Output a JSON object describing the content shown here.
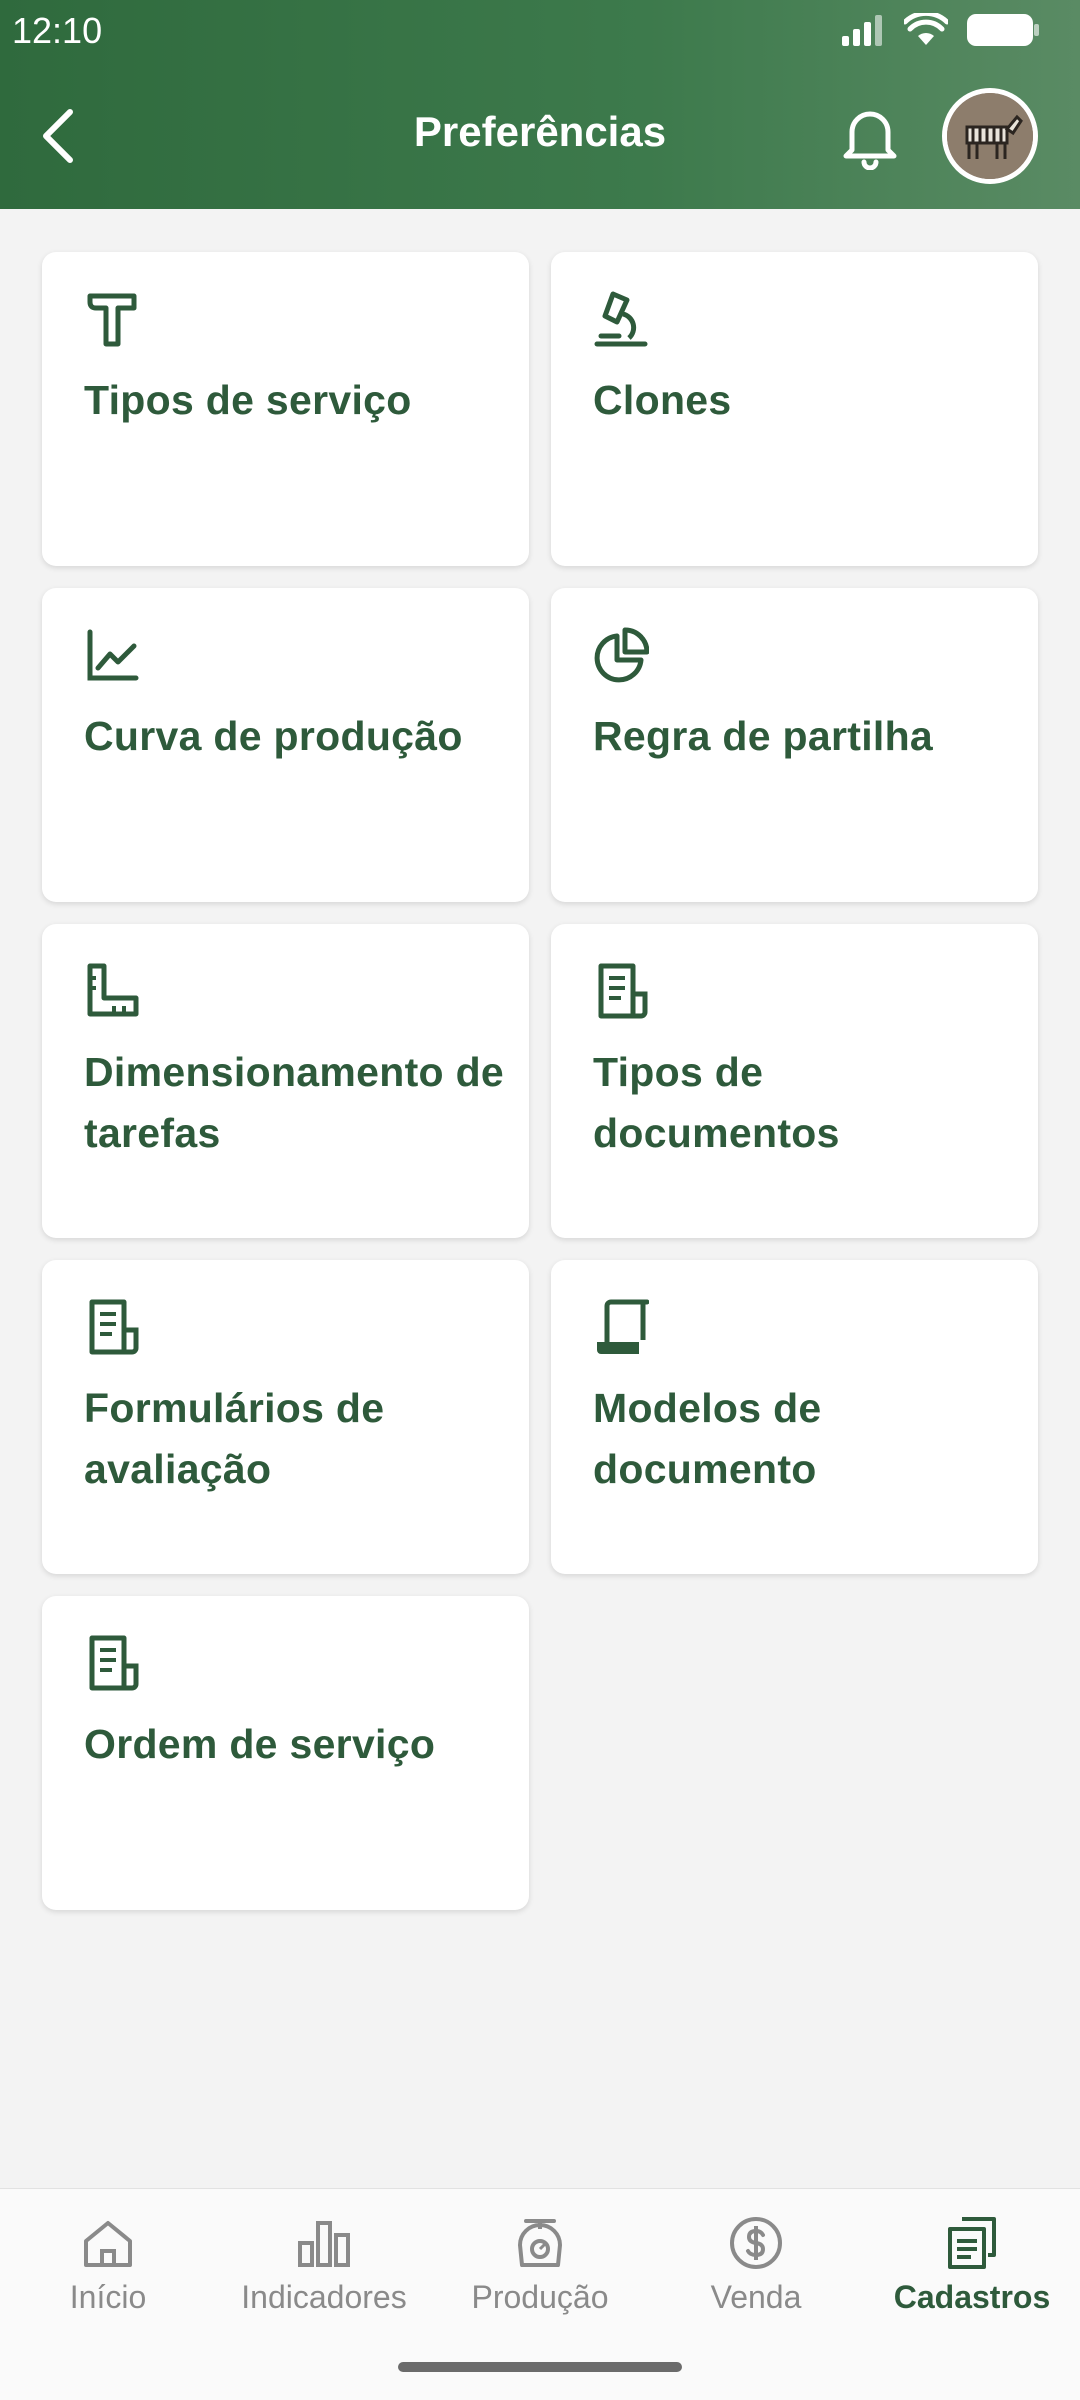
{
  "status_bar": {
    "time": "12:10"
  },
  "header": {
    "title": "Preferências"
  },
  "cards": [
    {
      "label": "Tipos de serviço",
      "icon": "hammer-icon"
    },
    {
      "label": "Clones",
      "icon": "microscope-icon"
    },
    {
      "label": "Curva de produção",
      "icon": "line-chart-icon"
    },
    {
      "label": "Regra de partilha",
      "icon": "pie-chart-icon"
    },
    {
      "label": "Dimensionamento de tarefas",
      "icon": "ruler-icon"
    },
    {
      "label": "Tipos de documentos",
      "icon": "document-icon"
    },
    {
      "label": "Formulários de avaliação",
      "icon": "document-icon"
    },
    {
      "label": "Modelos de documento",
      "icon": "scroll-icon"
    },
    {
      "label": "Ordem de serviço",
      "icon": "document-icon"
    }
  ],
  "bottom_nav": [
    {
      "label": "Início",
      "icon": "home-icon"
    },
    {
      "label": "Indicadores",
      "icon": "bar-chart-icon"
    },
    {
      "label": "Produção",
      "icon": "scale-icon"
    },
    {
      "label": "Venda",
      "icon": "dollar-icon"
    },
    {
      "label": "Cadastros",
      "icon": "documents-icon",
      "active": true
    }
  ],
  "colors": {
    "header": "#2f6a3d",
    "accent": "#2e5a3b",
    "inactive": "#8a8a8a",
    "background": "#f3f3f3"
  }
}
